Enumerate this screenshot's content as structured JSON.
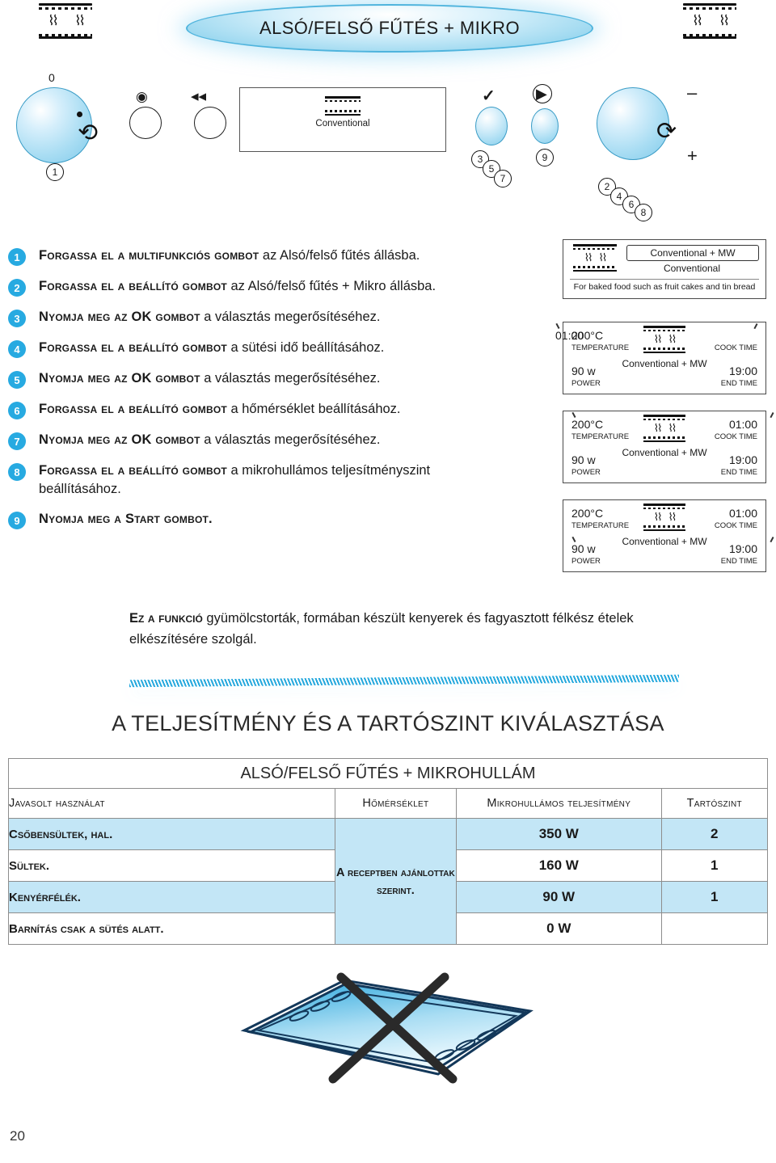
{
  "header": {
    "title": "ALSÓ/FELSŐ FŰTÉS + MIKRO",
    "corner_icon_left": "heating-element-microwave-icon",
    "corner_icon_right": "heating-element-microwave-icon"
  },
  "control_panel": {
    "function_knob": {
      "label_zero": "0",
      "marker": "1",
      "icon": "rotate-knob-icon"
    },
    "stop_button": {
      "icon": "stop-square-icon",
      "label": ""
    },
    "back_button": {
      "icon": "rewind-double-left-icon",
      "label": ""
    },
    "display": {
      "mode_text": "Conventional",
      "icon": "conventional-heating-icon"
    },
    "ok_button": {
      "icon": "check-mark-icon",
      "markers": [
        "3",
        "5",
        "7"
      ]
    },
    "start_button": {
      "icon": "play-circle-icon",
      "markers": [
        "9"
      ]
    },
    "setting_knob": {
      "minus": "–",
      "plus": "+",
      "markers": [
        "2",
        "4",
        "6",
        "8"
      ],
      "icon": "rotate-knob-icon"
    }
  },
  "steps": [
    {
      "num": "1",
      "strong": "Forgassa el a multifunkciós gombot",
      "rest": " az Alsó/felső fűtés állásba."
    },
    {
      "num": "2",
      "strong": "Forgassa el a beállító gombot",
      "rest": " az Alsó/felső fűtés + Mikro állásba."
    },
    {
      "num": "3",
      "strong": "Nyomja meg az OK gombot",
      "rest": " a választás megerősítéséhez."
    },
    {
      "num": "4",
      "strong": "Forgassa el a beállító gombot",
      "rest": " a sütési idő beállításához."
    },
    {
      "num": "5",
      "strong": "Nyomja meg az OK gombot",
      "rest": " a választás megerősítéséhez."
    },
    {
      "num": "6",
      "strong": "Forgassa el a beállító gombot",
      "rest": " a hőmérséklet beállításához."
    },
    {
      "num": "7",
      "strong": "Nyomja meg az OK gombot",
      "rest": " a választás megerősítéséhez."
    },
    {
      "num": "8",
      "strong": "Forgassa el a beállító gombot",
      "rest": " a mikrohullámos teljesítményszint beállításához."
    },
    {
      "num": "9",
      "strong": "Nyomja meg a Start gombot.",
      "rest": ""
    }
  ],
  "panels": {
    "panel1": {
      "selected_mode": "Conventional + MW",
      "sub_mode": "Conventional",
      "description": "For baked food such as fruit cakes and tin bread"
    },
    "panel2": {
      "temperature_value": "200°C",
      "temperature_label": "TEMPERATURE",
      "power_value": "90 w",
      "power_label": "POWER",
      "cook_time_value": "01:00",
      "cook_time_label": "COOK TIME",
      "end_time_value": "19:00",
      "end_time_label": "END TIME",
      "mode": "Conventional + MW",
      "blinking": "cook-time"
    },
    "panel3": {
      "temperature_value": "200°C",
      "temperature_label": "TEMPERATURE",
      "power_value": "90 w",
      "power_label": "POWER",
      "cook_time_value": "01:00",
      "cook_time_label": "COOK TIME",
      "end_time_value": "19:00",
      "end_time_label": "END TIME",
      "mode": "Conventional + MW",
      "blinking": "temperature"
    },
    "panel4": {
      "temperature_value": "200°C",
      "temperature_label": "TEMPERATURE",
      "power_value": "90 w",
      "power_label": "POWER",
      "cook_time_value": "01:00",
      "cook_time_label": "COOK TIME",
      "end_time_value": "19:00",
      "end_time_label": "END TIME",
      "mode": "Conventional + MW",
      "blinking": "power"
    }
  },
  "note": {
    "strong": "Ez a funkció",
    "rest": " gyümölcstorták, formában készült kenyerek és fagyasztott félkész ételek elkészítésére szolgál."
  },
  "section_heading": "A TELJESÍTMÉNY ÉS A TARTÓSZINT KIVÁLASZTÁSA",
  "table": {
    "title": "ALSÓ/FELSŐ FŰTÉS + MIKROHULLÁM",
    "headers": [
      "Javasolt használat",
      "Hőmérséklet",
      "Mikrohullámos teljesítmény",
      "Tartószint"
    ],
    "temperature_merged": "A receptben ajánlottak szerint.",
    "rows": [
      {
        "use": "Csőbensültek, hal.",
        "power": "350 W",
        "level": "2"
      },
      {
        "use": "Sültek.",
        "power": "160 W",
        "level": "1"
      },
      {
        "use": "Kenyérfélék.",
        "power": "90 W",
        "level": "1"
      },
      {
        "use": "Barnítás csak a sütés alatt.",
        "power": "0 W",
        "level": ""
      }
    ]
  },
  "illustration": {
    "name": "baking-tray-not-allowed",
    "caption": ""
  },
  "page_number": "20",
  "colors": {
    "accent": "#27aae1",
    "table_row_blue": "#c3e6f6",
    "banner_blue": "#7ccbea"
  }
}
